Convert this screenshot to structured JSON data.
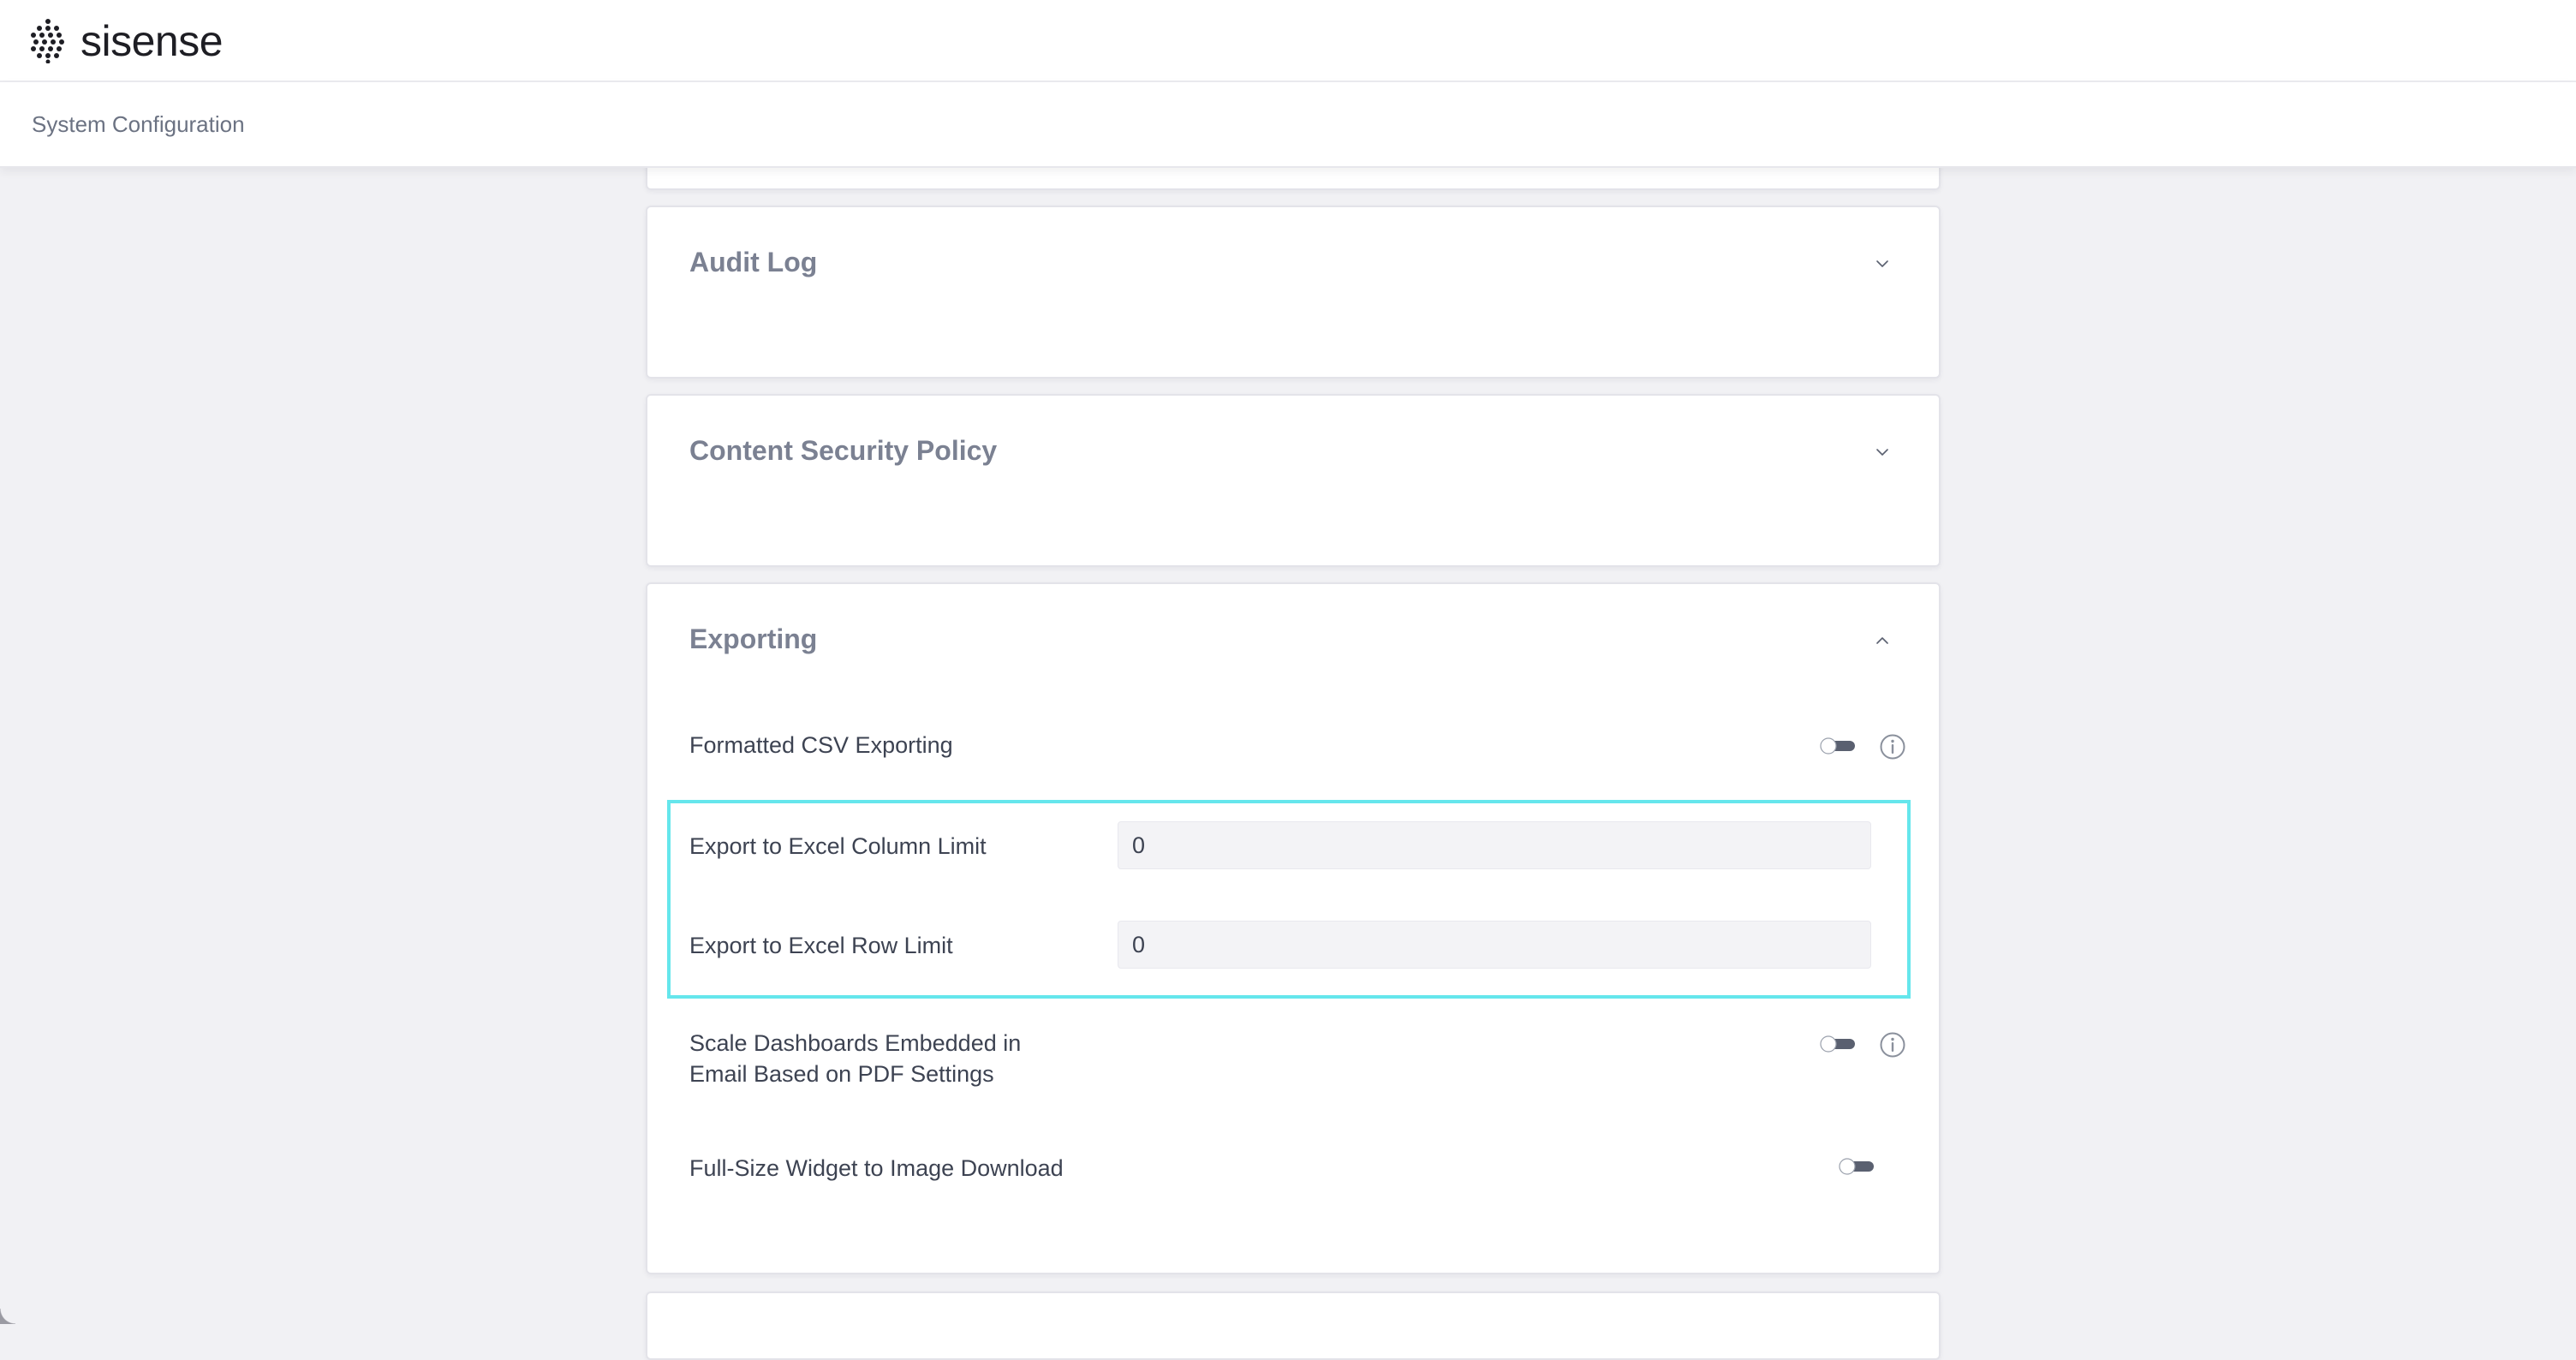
{
  "app": {
    "brand_name": "sisense",
    "logo_icon": "sisense-dot-grid-logo"
  },
  "header": {
    "page_title": "System Configuration"
  },
  "sections": {
    "audit_log": {
      "title": "Audit Log",
      "expanded": false,
      "icon": "chevron-down-icon"
    },
    "content_security_policy": {
      "title": "Content Security Policy",
      "expanded": false,
      "icon": "chevron-down-icon"
    },
    "exporting": {
      "title": "Exporting",
      "expanded": true,
      "icon": "chevron-up-icon",
      "settings": {
        "formatted_csv": {
          "label": "Formatted CSV Exporting",
          "enabled": false
        },
        "excel_column_limit": {
          "label": "Export to Excel Column Limit",
          "value": "0"
        },
        "excel_row_limit": {
          "label": "Export to Excel Row Limit",
          "value": "0"
        },
        "scale_dashboards": {
          "label": "Scale Dashboards Embedded in Email Based on PDF Settings",
          "enabled": false
        },
        "full_size_widget": {
          "label": "Full-Size Widget to Image Download",
          "enabled": false
        }
      }
    }
  },
  "colors": {
    "background": "#f1f1f4",
    "card": "#ffffff",
    "highlight": "#65e6ec",
    "toggle_off": "#5a6070",
    "title_text": "#7b8192"
  }
}
